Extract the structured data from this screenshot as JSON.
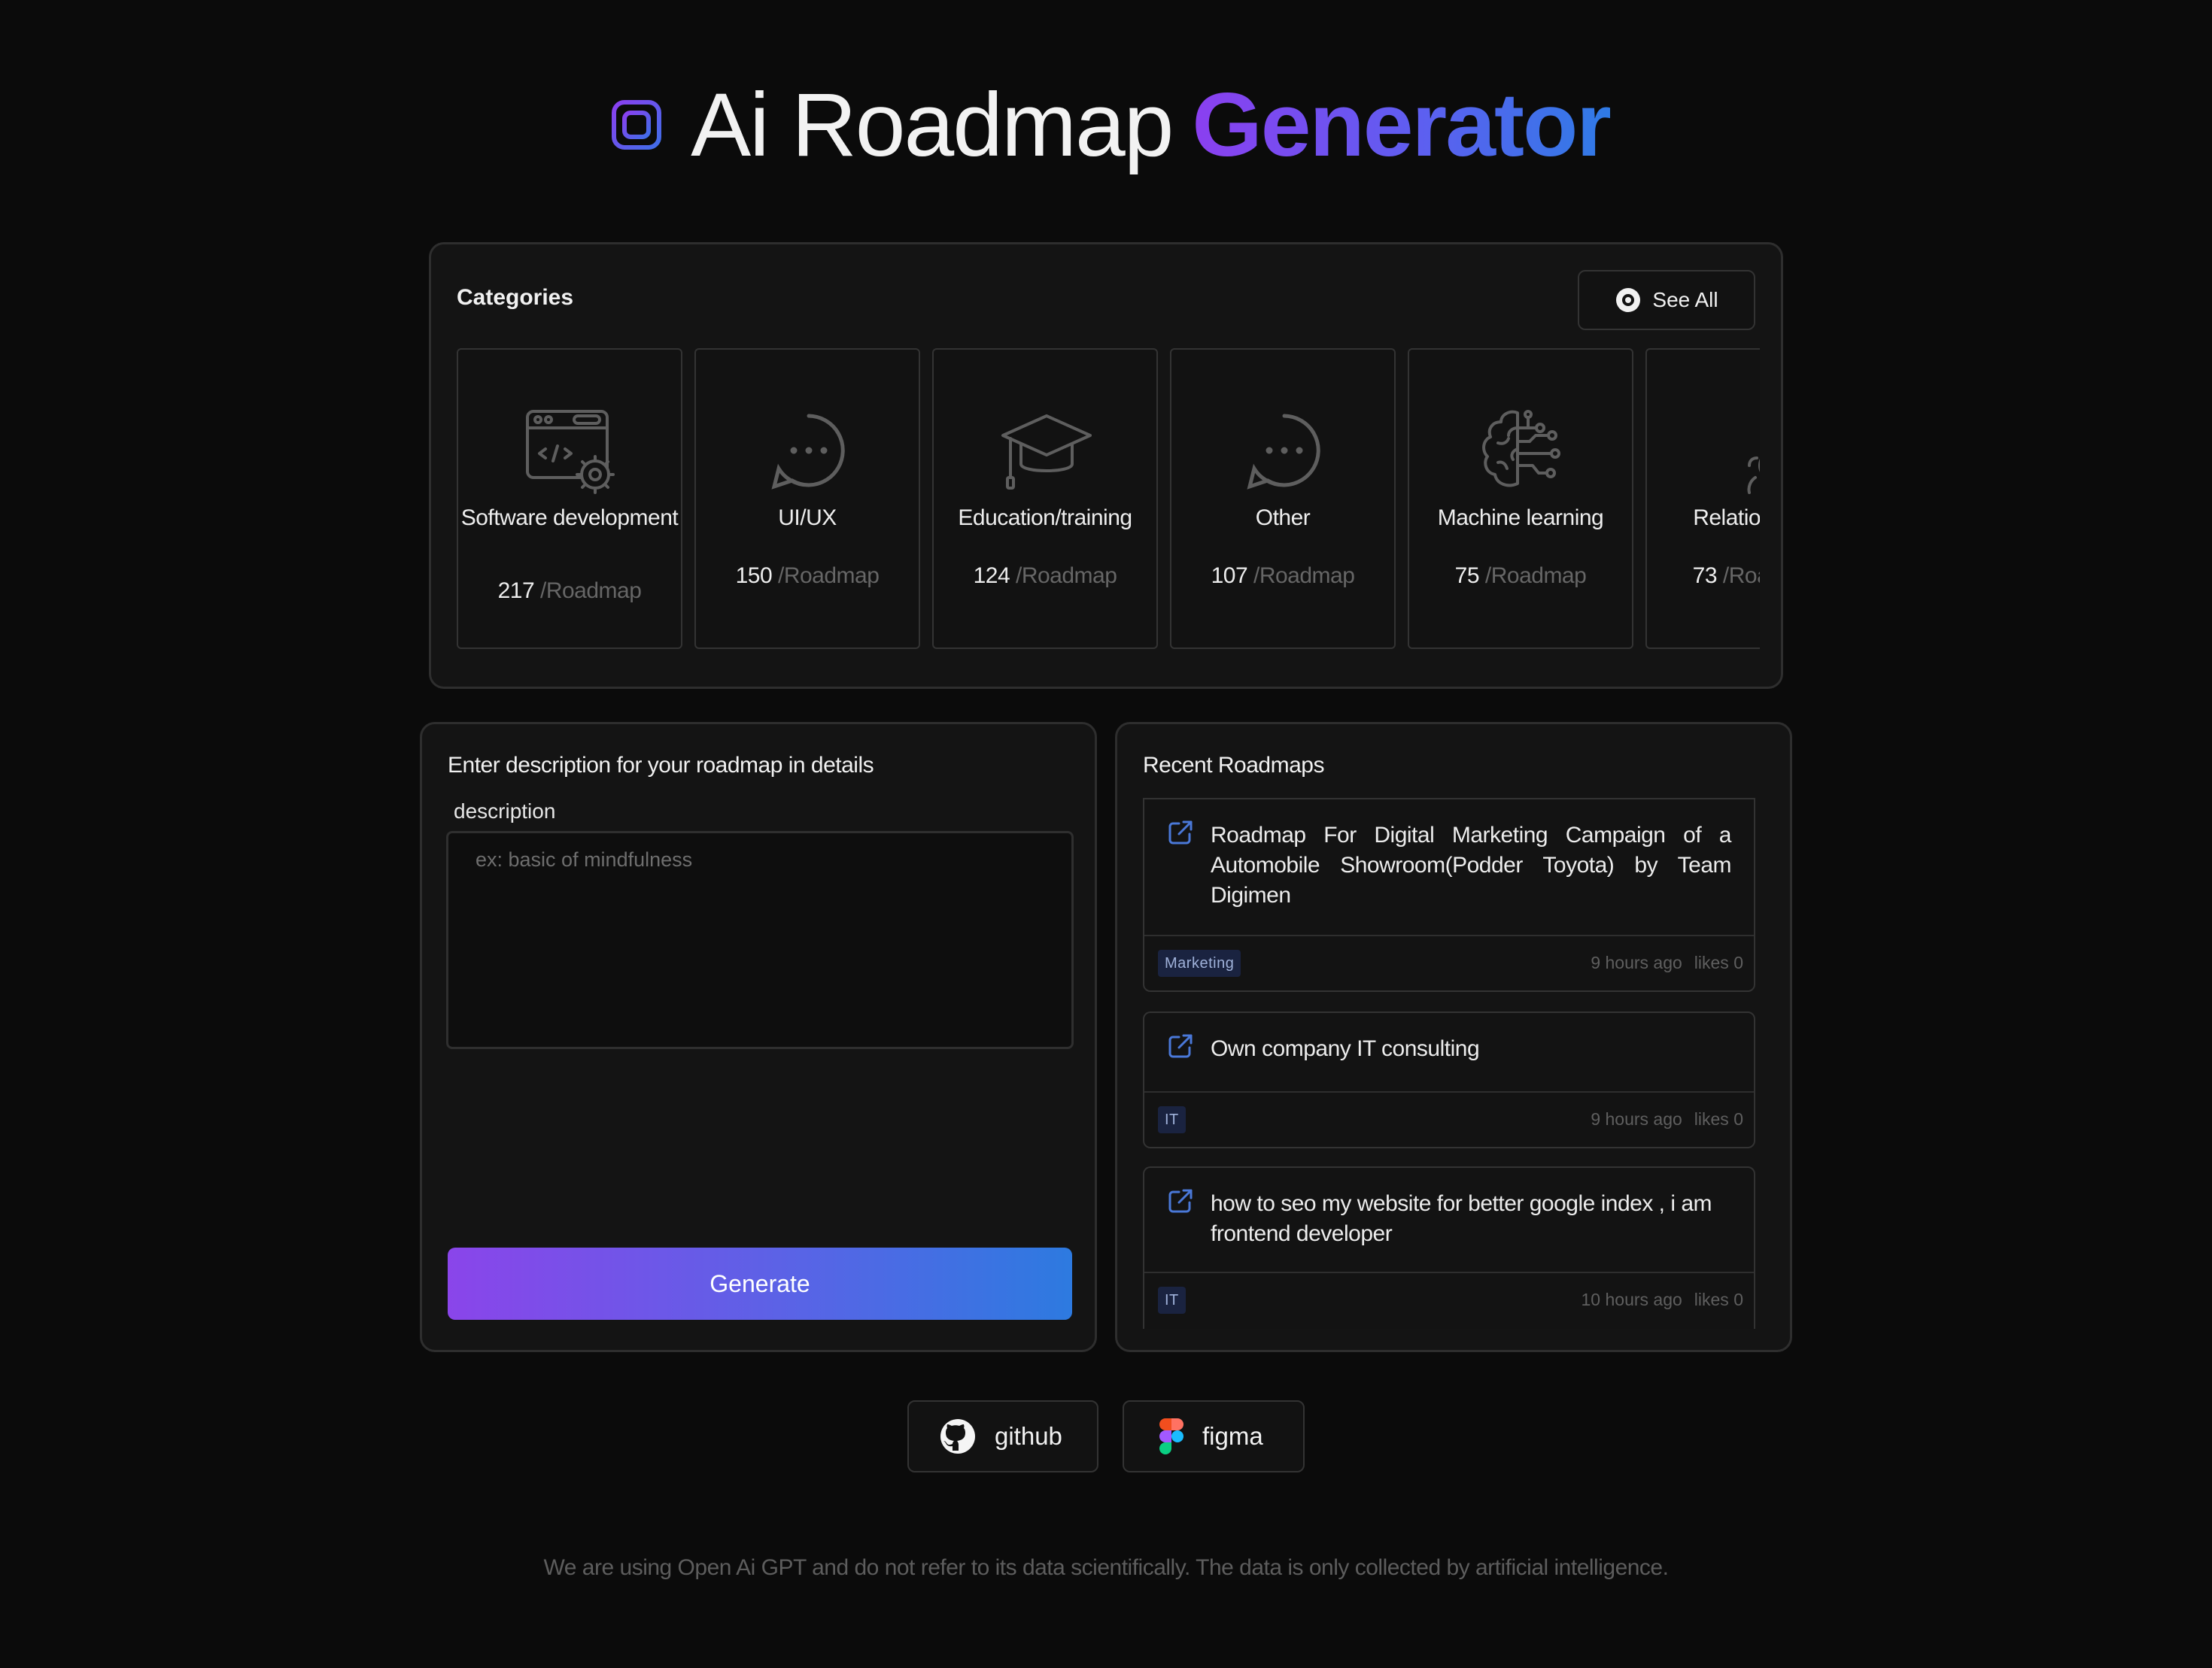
{
  "header": {
    "logo_icon": "cpu-chip-icon",
    "title_plain": "Ai Roadmap",
    "title_accent": "Generator"
  },
  "categories": {
    "title": "Categories",
    "see_all_label": "See All",
    "see_all_icon": "eye-icon",
    "items": [
      {
        "name": "Software development",
        "count": "217",
        "unit": "/Roadmap",
        "icon": "code-window-gear-icon"
      },
      {
        "name": "UI/UX",
        "count": "150",
        "unit": "/Roadmap",
        "icon": "chat-bubble-dots-icon"
      },
      {
        "name": "Education/training",
        "count": "124",
        "unit": "/Roadmap",
        "icon": "graduation-cap-icon"
      },
      {
        "name": "Other",
        "count": "107",
        "unit": "/Roadmap",
        "icon": "chat-bubble-dots-icon"
      },
      {
        "name": "Machine learning",
        "count": "75",
        "unit": "/Roadmap",
        "icon": "brain-circuit-icon"
      },
      {
        "name": "Relationships",
        "count": "73",
        "unit": "/Roadmap",
        "icon": "couple-heart-icon"
      }
    ]
  },
  "description_form": {
    "heading": "Enter description for your roadmap in details",
    "label": "description",
    "placeholder": "ex: basic of mindfulness",
    "value": "",
    "button_label": "Generate"
  },
  "recent": {
    "heading": "Recent Roadmaps",
    "items": [
      {
        "title": "Roadmap For Digital Marketing Campaign of a Automobile Showroom(Podder Toyota) by Team Digimen",
        "tag": "Marketing",
        "time": "9 hours ago",
        "likes": "likes 0"
      },
      {
        "title": "Own company IT consulting",
        "tag": "IT",
        "time": "9 hours ago",
        "likes": "likes 0"
      },
      {
        "title": "how to seo my website for better google index , i am frontend developer",
        "tag": "IT",
        "time": "10 hours ago",
        "likes": "likes 0"
      }
    ]
  },
  "links": {
    "github_label": "github",
    "figma_label": "figma"
  },
  "footer_note": "We are using Open Ai GPT and do not refer to its data scientifically. The data is only collected by artificial intelligence.",
  "colors": {
    "background": "#0b0b0b",
    "panel": "#141414",
    "accent_purple": "#8b3ff0",
    "accent_blue": "#2f7be6",
    "tag_bg": "#1a2340"
  }
}
